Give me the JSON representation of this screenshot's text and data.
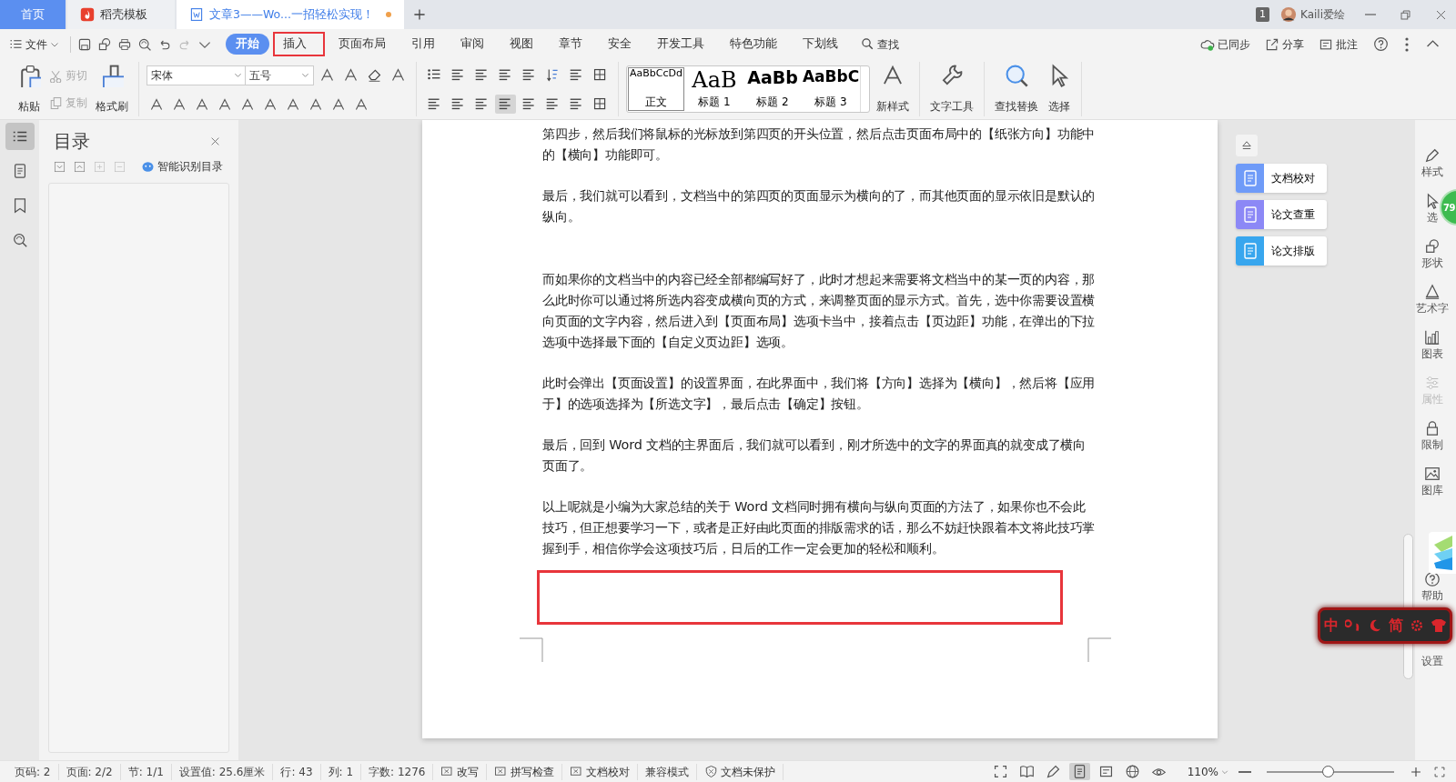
{
  "title_tabs": [
    {
      "label": "首页",
      "kind": "home",
      "selected": false,
      "unsaved": false
    },
    {
      "label": "稻壳模板",
      "kind": "app",
      "selected": false,
      "unsaved": false
    },
    {
      "label": "文章3——Wo...一招轻松实现！",
      "kind": "doc",
      "selected": true,
      "unsaved": true
    }
  ],
  "window_badge": "1",
  "user": "Kaili爱绘",
  "menu": {
    "file": "文件",
    "tabs": [
      {
        "label": "开始",
        "selected": true,
        "annotated": false
      },
      {
        "label": "插入",
        "selected": false,
        "annotated": true
      },
      {
        "label": "页面布局",
        "selected": false,
        "annotated": false
      },
      {
        "label": "引用",
        "selected": false,
        "annotated": false
      },
      {
        "label": "审阅",
        "selected": false,
        "annotated": false
      },
      {
        "label": "视图",
        "selected": false,
        "annotated": false
      },
      {
        "label": "章节",
        "selected": false,
        "annotated": false
      },
      {
        "label": "安全",
        "selected": false,
        "annotated": false
      },
      {
        "label": "开发工具",
        "selected": false,
        "annotated": false
      },
      {
        "label": "特色功能",
        "selected": false,
        "annotated": false
      },
      {
        "label": "下划线",
        "selected": false,
        "annotated": false
      }
    ],
    "search": "查找",
    "actions": [
      "已同步",
      "分享",
      "批注"
    ]
  },
  "clipboard": [
    {
      "label": "粘贴",
      "kind": "large",
      "disabled": false
    },
    {
      "label": "剪切",
      "kind": "small",
      "disabled": true
    },
    {
      "label": "复制",
      "kind": "small",
      "disabled": true
    },
    {
      "label": "格式刷",
      "kind": "large",
      "disabled": false
    }
  ],
  "font": {
    "family": "宋体",
    "size": "五号"
  },
  "styles": [
    {
      "sample": "AaBbCcDd",
      "label": "正文",
      "selected": true
    },
    {
      "sample": "AaB",
      "label": "标题 1",
      "selected": false
    },
    {
      "sample": "AaBb",
      "label": "标题 2",
      "selected": false
    },
    {
      "sample": "AaBbC",
      "label": "标题 3",
      "selected": false
    }
  ],
  "tools": [
    "新样式",
    "文字工具",
    "查找替换",
    "选择"
  ],
  "outline": {
    "title": "目录",
    "smart": "智能识别目录"
  },
  "paragraphs": [
    {
      "text": "第四步，然后我们将鼠标的光标放到第四页的开头位置，然后点击页面布局中的【纸张方向】功能中的【横向】功能即可。"
    },
    {
      "text": "最后，我们就可以看到，文档当中的第四页的页面显示为横向的了，而其他页面的显示依旧是默认的纵向。"
    },
    {
      "text": "而如果你的文档当中的内容已经全部都编写好了，此时才想起来需要将文档当中的某一页的内容，那么此时你可以通过将所选内容变成横向页的方式，来调整页面的显示方式。首先，选中你需要设置横向页面的文字内容，然后进入到【页面布局】选项卡当中，接着点击【页边距】功能，在弹出的下拉选项中选择最下面的【自定义页边距】选项。"
    },
    {
      "text": "此时会弹出【页面设置】的设置界面，在此界面中，我们将【方向】选择为【横向】，然后将【应用于】的选项选择为【所选文字】，最后点击【确定】按钮。"
    },
    {
      "text": "最后，回到 Word 文档的主界面后，我们就可以看到，刚才所选中的文字的界面真的就变成了横向页面了。"
    },
    {
      "text": "以上呢就是小编为大家总结的关于 Word 文档同时拥有横向与纵向页面的方法了，如果你也不会此技巧，但正想要学习一下，或者是正好由此页面的排版需求的话，那么不妨赶快跟着本文将此技巧掌握到手，相信你学会这项技巧后，日后的工作一定会更加的轻松和顺利。"
    }
  ],
  "side_tools": [
    {
      "label": "文档校对",
      "color": "#6f9bf8"
    },
    {
      "label": "论文查重",
      "color": "#8c88f6"
    },
    {
      "label": "论文排版",
      "color": "#38a6ee"
    }
  ],
  "right_rail": [
    {
      "label": "样式",
      "disabled": false
    },
    {
      "label": "选",
      "disabled": false
    },
    {
      "label": "形状",
      "disabled": false
    },
    {
      "label": "艺术字",
      "disabled": false
    },
    {
      "label": "图表",
      "disabled": false
    },
    {
      "label": "属性",
      "disabled": true
    },
    {
      "label": "限制",
      "disabled": false
    },
    {
      "label": "图库",
      "disabled": false
    },
    {
      "label": "帮助",
      "disabled": false
    },
    {
      "label": "设置",
      "disabled": false
    }
  ],
  "float_badge": "79",
  "ime": {
    "mode": "中",
    "script": "简"
  },
  "status": [
    "页码: 2",
    "页面: 2/2",
    "节: 1/1",
    "设置值: 25.6厘米",
    "行: 43",
    "列: 1",
    "字数: 1276"
  ],
  "status_toggles": [
    "改写",
    "拼写检查",
    "文档校对"
  ],
  "compat": "兼容模式",
  "protect": "文档未保护",
  "view_modes": [
    {
      "selected": false
    },
    {
      "selected": false
    },
    {
      "selected": false
    },
    {
      "selected": true
    },
    {
      "selected": false
    },
    {
      "selected": false
    },
    {
      "selected": false
    }
  ],
  "zoom": {
    "reading": "110%",
    "level": 0.48
  }
}
